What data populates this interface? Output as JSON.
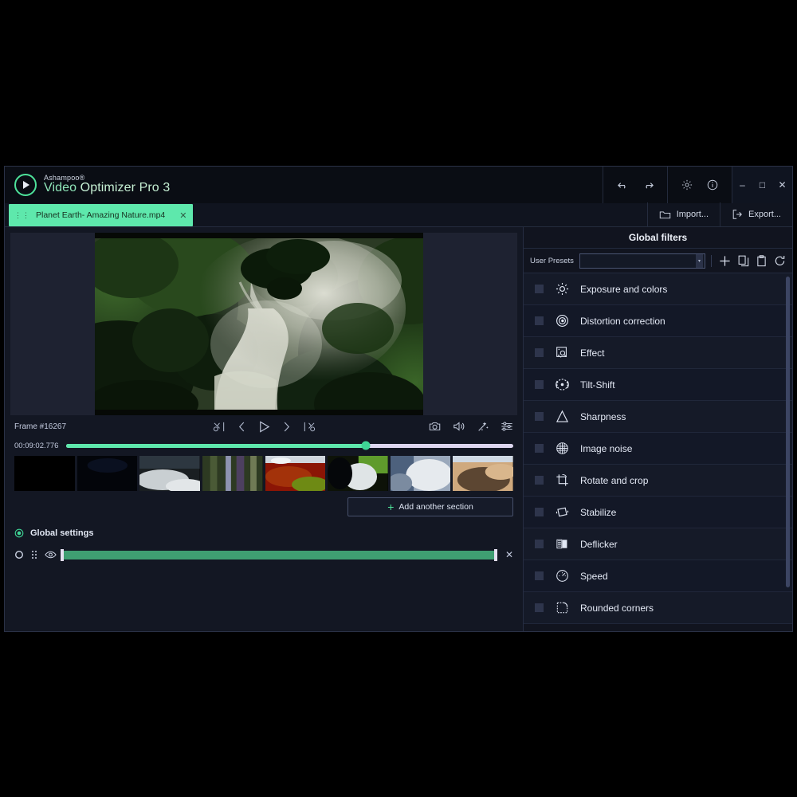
{
  "app": {
    "brand_top": "Ashampoo®",
    "brand_name_1": "Video",
    "brand_name_2": " Optimizer Pro 3",
    "logo_icon": "play-circle-icon"
  },
  "titlebar": {
    "undo_icon": "undo-arrow-icon",
    "redo_icon": "redo-arrow-icon",
    "settings_icon": "gear-icon",
    "info_icon": "info-circle-icon",
    "minimize_label": "–",
    "maximize_label": "□",
    "close_label": "✕"
  },
  "tabbar": {
    "tab": {
      "grip_icon": "drag-grip-icon",
      "title": "Planet Earth- Amazing Nature.mp4",
      "close_label": "✕"
    },
    "import_label": "Import...",
    "import_icon": "folder-icon",
    "export_label": "Export...",
    "export_icon": "export-arrow-icon"
  },
  "player": {
    "frame_label": "Frame #16267",
    "time_label": "00:09:02.776",
    "progress_percent": 67,
    "controls": [
      {
        "name": "mark-in-icon"
      },
      {
        "name": "previous-frame-icon"
      },
      {
        "name": "play-icon"
      },
      {
        "name": "next-frame-icon"
      },
      {
        "name": "mark-out-icon"
      }
    ],
    "tools": [
      {
        "name": "snapshot-camera-icon"
      },
      {
        "name": "volume-icon"
      },
      {
        "name": "magic-wand-icon"
      },
      {
        "name": "adjust-sliders-icon"
      }
    ],
    "thumbnails": [
      {
        "label": "thumb-1-black"
      },
      {
        "label": "thumb-2-dark"
      },
      {
        "label": "thumb-3-waterfall-mist"
      },
      {
        "label": "thumb-4-forest"
      },
      {
        "label": "thumb-5-red-autumn"
      },
      {
        "label": "thumb-6-waterfall-green"
      },
      {
        "label": "thumb-7-ice-falls"
      },
      {
        "label": "thumb-8-desert-dunes"
      }
    ]
  },
  "timeline": {
    "add_section_label": "Add another section",
    "add_section_icon": "plus-icon",
    "global_settings_label": "Global settings",
    "global_settings_icon": "target-dot-icon",
    "row_icons": [
      {
        "name": "record-circle-icon"
      },
      {
        "name": "drag-grip-icon"
      },
      {
        "name": "eye-icon"
      }
    ],
    "row_close_label": "✕"
  },
  "filters_panel": {
    "title": "Global filters",
    "preset_label": "User Presets",
    "preset_value": "",
    "preset_actions": [
      {
        "name": "add-preset-icon"
      },
      {
        "name": "copy-preset-icon"
      },
      {
        "name": "paste-preset-icon"
      },
      {
        "name": "reset-preset-icon"
      }
    ],
    "items": [
      {
        "label": "Exposure and colors",
        "icon": "sun-icon",
        "checked": false
      },
      {
        "label": "Distortion correction",
        "icon": "lens-distortion-icon",
        "checked": false
      },
      {
        "label": "Effect",
        "icon": "effect-magnify-icon",
        "checked": false
      },
      {
        "label": "Tilt-Shift",
        "icon": "tilt-shift-icon",
        "checked": false
      },
      {
        "label": "Sharpness",
        "icon": "triangle-sharpness-icon",
        "checked": false
      },
      {
        "label": "Image noise",
        "icon": "grid-sphere-noise-icon",
        "checked": false
      },
      {
        "label": "Rotate and crop",
        "icon": "crop-rotate-icon",
        "checked": false
      },
      {
        "label": "Stabilize",
        "icon": "stabilize-icon",
        "checked": false
      },
      {
        "label": "Deflicker",
        "icon": "deflicker-icon",
        "checked": false
      },
      {
        "label": "Speed",
        "icon": "speedometer-icon",
        "checked": false
      },
      {
        "label": "Rounded corners",
        "icon": "rounded-corners-icon",
        "checked": false
      }
    ]
  },
  "colors": {
    "accent_green": "#5ee8ac",
    "panel_bg": "#11141f",
    "window_bg": "#131723",
    "titlebar_bg": "#0a0d14"
  }
}
